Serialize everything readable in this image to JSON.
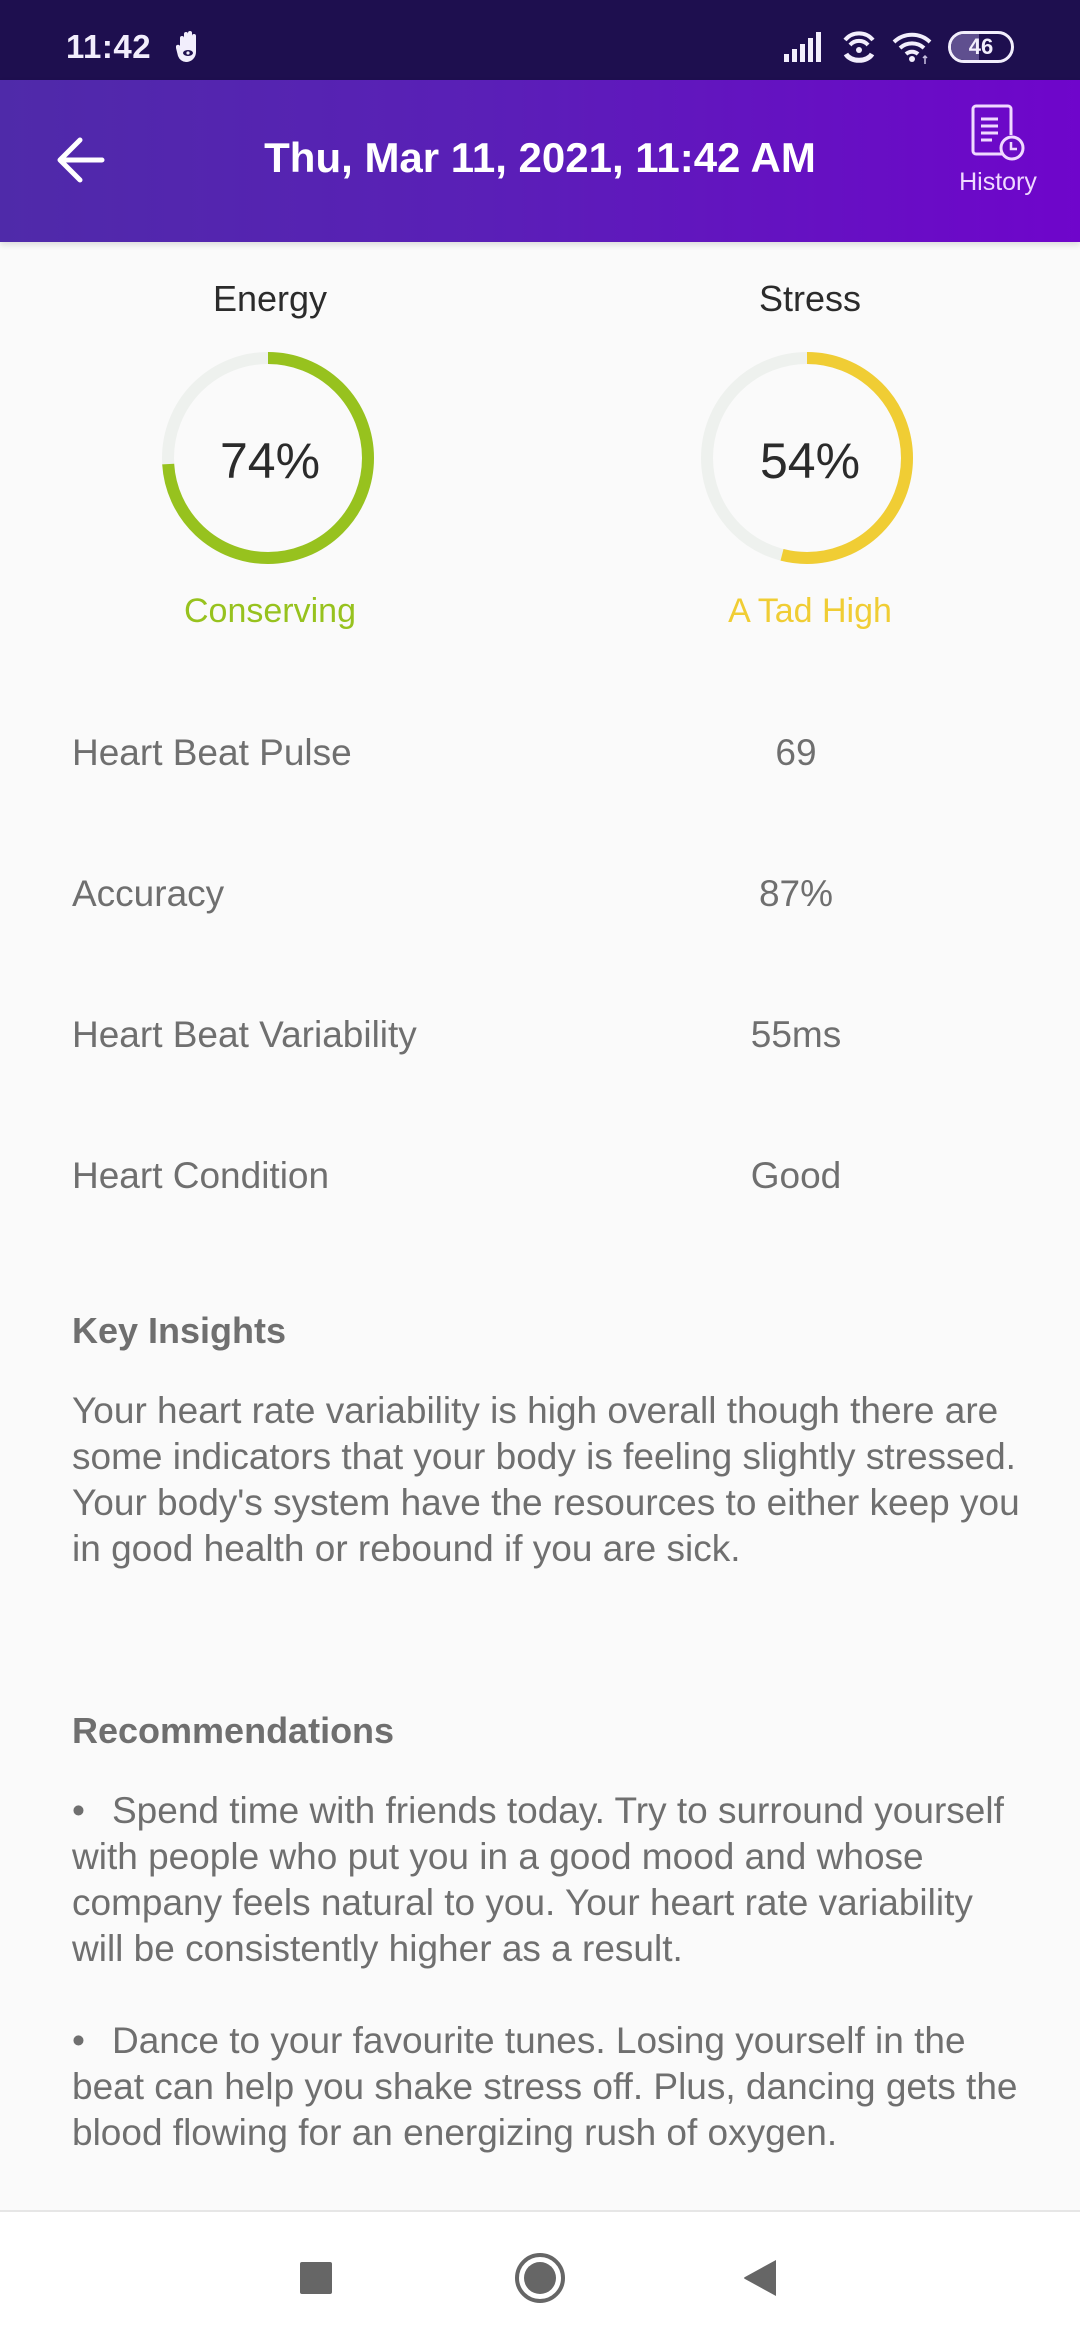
{
  "status_bar": {
    "time": "11:42",
    "notification_icon": "hand-eye-icon",
    "icons": [
      "signal-icon",
      "hotspot-icon",
      "wifi-icon"
    ],
    "battery": "46",
    "battery_level": 0.46
  },
  "header": {
    "back_icon": "arrow-left-icon",
    "title": "Thu, Mar 11, 2021, 11:42 AM",
    "history_label": "History",
    "history_icon": "document-clock-icon",
    "gradient_start": "#4f2aa9",
    "gradient_end": "#6f05cb"
  },
  "gauges": [
    {
      "title": "Energy",
      "value_label": "74%",
      "percent": 74,
      "status": "Conserving",
      "color": "#97c21e",
      "track_color": "#eef1ee"
    },
    {
      "title": "Stress",
      "value_label": "54%",
      "percent": 54,
      "status": "A Tad High",
      "color": "#f0cd34",
      "track_color": "#eef1ee"
    }
  ],
  "metrics": [
    {
      "label": "Heart Beat Pulse",
      "value": "69"
    },
    {
      "label": "Accuracy",
      "value": "87%"
    },
    {
      "label": "Heart Beat Variability",
      "value": "55ms"
    },
    {
      "label": "Heart Condition",
      "value": "Good"
    }
  ],
  "insights": {
    "title": "Key Insights",
    "text": "Your heart rate variability is high overall though there are some indicators that your body is feeling slightly stressed. Your body's system have the resources to either keep you in good health or rebound if you are sick."
  },
  "recommendations": {
    "title": "Recommendations",
    "bullet": "•",
    "items": [
      "Spend time with friends today. Try to surround yourself with people who put you in a good mood and whose company feels natural to you. Your heart rate variability will be consistently higher as a result.",
      "Dance to your favourite tunes. Losing yourself in the beat can help you shake stress off. Plus, dancing gets the blood flowing for an energizing rush of oxygen."
    ]
  },
  "nav_bar": {
    "recents_icon": "square-icon",
    "home_icon": "circle-icon",
    "back_icon": "triangle-back-icon"
  }
}
